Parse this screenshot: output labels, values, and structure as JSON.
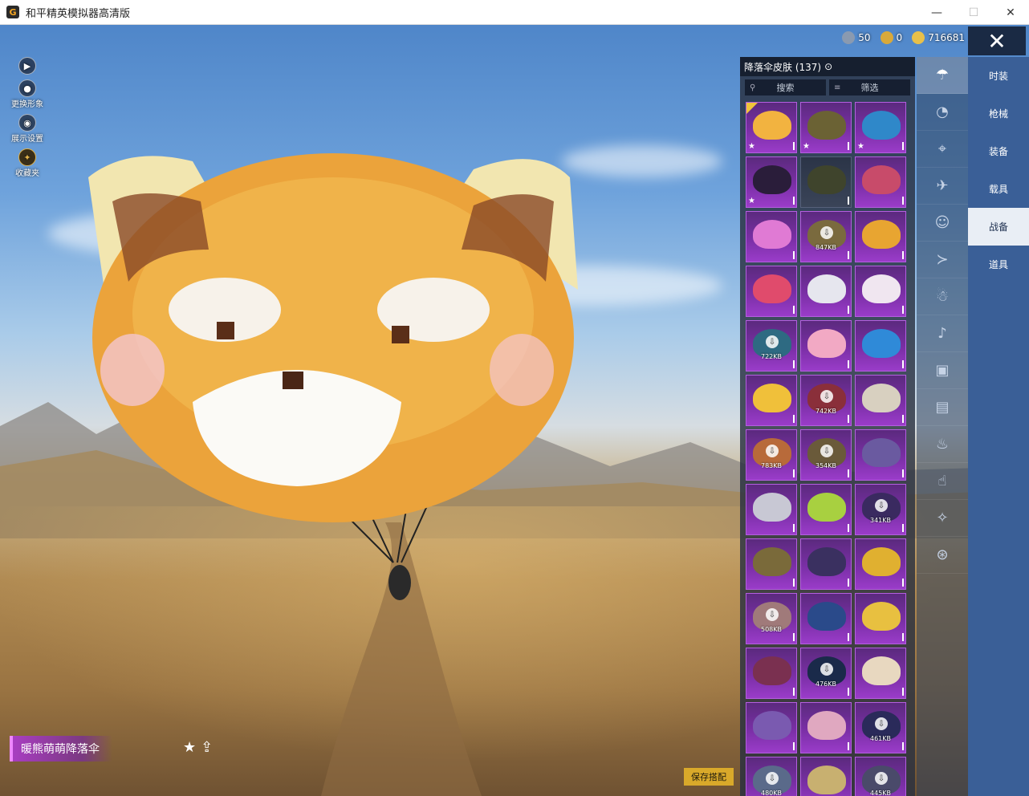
{
  "window": {
    "title": "和平精英模拟器高清版",
    "app_icon": "G",
    "controls": {
      "minimize": "—",
      "maximize": "☐",
      "close": "✕"
    }
  },
  "left_tools": [
    {
      "label": "",
      "icon": "play-icon",
      "glyph": "▶"
    },
    {
      "label": "更换形象",
      "icon": "avatar-icon",
      "glyph": "●"
    },
    {
      "label": "展示设置",
      "icon": "eye-icon",
      "glyph": "◉"
    },
    {
      "label": "收藏夹",
      "icon": "badge-icon",
      "glyph": "✦"
    }
  ],
  "currency": [
    {
      "value": "50",
      "color": "#8a9ab0"
    },
    {
      "value": "0",
      "color": "#d9a93a"
    },
    {
      "value": "716681",
      "color": "#e8c04a"
    }
  ],
  "close_button": "✕",
  "panel": {
    "title": "降落伞皮肤 (137)",
    "title_icon": "⊙",
    "search_label": "搜索",
    "filter_label": "筛选",
    "filter_icon": "≡"
  },
  "grid_items": [
    {
      "style": "purple",
      "chute": "#f2b340",
      "star": true,
      "checked": true,
      "size": ""
    },
    {
      "style": "purple",
      "chute": "#6b6234",
      "star": true,
      "size": ""
    },
    {
      "style": "purple",
      "chute": "#2f88c9",
      "star": true,
      "size": ""
    },
    {
      "style": "purple",
      "chute": "#2a1d3a",
      "star": true,
      "size": ""
    },
    {
      "style": "dark",
      "chute": "#3f442c",
      "size": ""
    },
    {
      "style": "purple",
      "chute": "#c84b6a",
      "size": ""
    },
    {
      "style": "purple",
      "chute": "#e07ad4",
      "size": ""
    },
    {
      "style": "purple",
      "chute": "#7a6a3e",
      "download": true,
      "size": "847KB"
    },
    {
      "style": "purple",
      "chute": "#e8a531",
      "size": ""
    },
    {
      "style": "purple",
      "chute": "#e04b6c",
      "size": ""
    },
    {
      "style": "purple",
      "chute": "#e6e6ee",
      "size": ""
    },
    {
      "style": "purple",
      "chute": "#f0e6f0",
      "size": ""
    },
    {
      "style": "purple",
      "chute": "#2e6a82",
      "download": true,
      "size": "722KB"
    },
    {
      "style": "purple",
      "chute": "#f2a9c4",
      "size": ""
    },
    {
      "style": "purple",
      "chute": "#2f8ad8",
      "size": ""
    },
    {
      "style": "purple",
      "chute": "#f0c03a",
      "size": ""
    },
    {
      "style": "purple",
      "chute": "#8a2f3a",
      "download": true,
      "size": "742KB"
    },
    {
      "style": "purple",
      "chute": "#d8d0c0",
      "size": ""
    },
    {
      "style": "purple",
      "chute": "#b86a3a",
      "download": true,
      "size": "783KB"
    },
    {
      "style": "purple",
      "chute": "#6a5a3a",
      "download": true,
      "size": "354KB"
    },
    {
      "style": "purple",
      "chute": "#6a5aa0",
      "size": ""
    },
    {
      "style": "purple",
      "chute": "#c8c8d4",
      "size": ""
    },
    {
      "style": "purple",
      "chute": "#a8d040",
      "size": ""
    },
    {
      "style": "purple",
      "chute": "#3a2a60",
      "download": true,
      "size": "341KB"
    },
    {
      "style": "purple",
      "chute": "#7a6a3a",
      "size": ""
    },
    {
      "style": "purple",
      "chute": "#3a3060",
      "size": ""
    },
    {
      "style": "purple",
      "chute": "#e0b030",
      "size": ""
    },
    {
      "style": "purple",
      "chute": "#a07a7a",
      "download": true,
      "size": "508KB"
    },
    {
      "style": "purple",
      "chute": "#2a4a8a",
      "size": ""
    },
    {
      "style": "purple",
      "chute": "#e8c040",
      "size": ""
    },
    {
      "style": "purple",
      "chute": "#7a3050",
      "size": ""
    },
    {
      "style": "purple",
      "chute": "#1a2a4a",
      "download": true,
      "size": "476KB"
    },
    {
      "style": "purple",
      "chute": "#e8d8c0",
      "size": ""
    },
    {
      "style": "purple",
      "chute": "#7a5ab0",
      "size": ""
    },
    {
      "style": "purple",
      "chute": "#e0a8c0",
      "size": ""
    },
    {
      "style": "purple",
      "chute": "#2a2a5a",
      "download": true,
      "size": "461KB"
    },
    {
      "style": "purple",
      "chute": "#5a6a8a",
      "download": true,
      "size": "480KB"
    },
    {
      "style": "purple",
      "chute": "#c8b070",
      "size": ""
    },
    {
      "style": "purple",
      "chute": "#4a4a6a",
      "download": true,
      "size": "445KB"
    }
  ],
  "icon_column": [
    {
      "name": "parachute-icon",
      "glyph": "☂",
      "active": true
    },
    {
      "name": "eye-wing-icon",
      "glyph": "◔"
    },
    {
      "name": "drone-icon",
      "glyph": "⌖"
    },
    {
      "name": "plane-icon",
      "glyph": "✈"
    },
    {
      "name": "face-icon",
      "glyph": "☺"
    },
    {
      "name": "glider-icon",
      "glyph": "≻"
    },
    {
      "name": "pet-icon",
      "glyph": "☃"
    },
    {
      "name": "sound-icon",
      "glyph": "♪"
    },
    {
      "name": "box-icon",
      "glyph": "▣"
    },
    {
      "name": "photo-icon",
      "glyph": "▤"
    },
    {
      "name": "extinguisher-icon",
      "glyph": "♨"
    },
    {
      "name": "hand-icon",
      "glyph": "☝"
    },
    {
      "name": "wand-icon",
      "glyph": "✧"
    },
    {
      "name": "ufo-icon",
      "glyph": "⊛"
    }
  ],
  "categories": [
    {
      "label": "时装",
      "active": false
    },
    {
      "label": "枪械",
      "active": false
    },
    {
      "label": "装备",
      "active": false
    },
    {
      "label": "载具",
      "active": false
    },
    {
      "label": "战备",
      "active": true
    },
    {
      "label": "道具",
      "active": false
    }
  ],
  "item_name": "暖熊萌萌降落伞",
  "item_actions": {
    "favorite": "★",
    "share": "⇪"
  },
  "save_button": "保存搭配"
}
